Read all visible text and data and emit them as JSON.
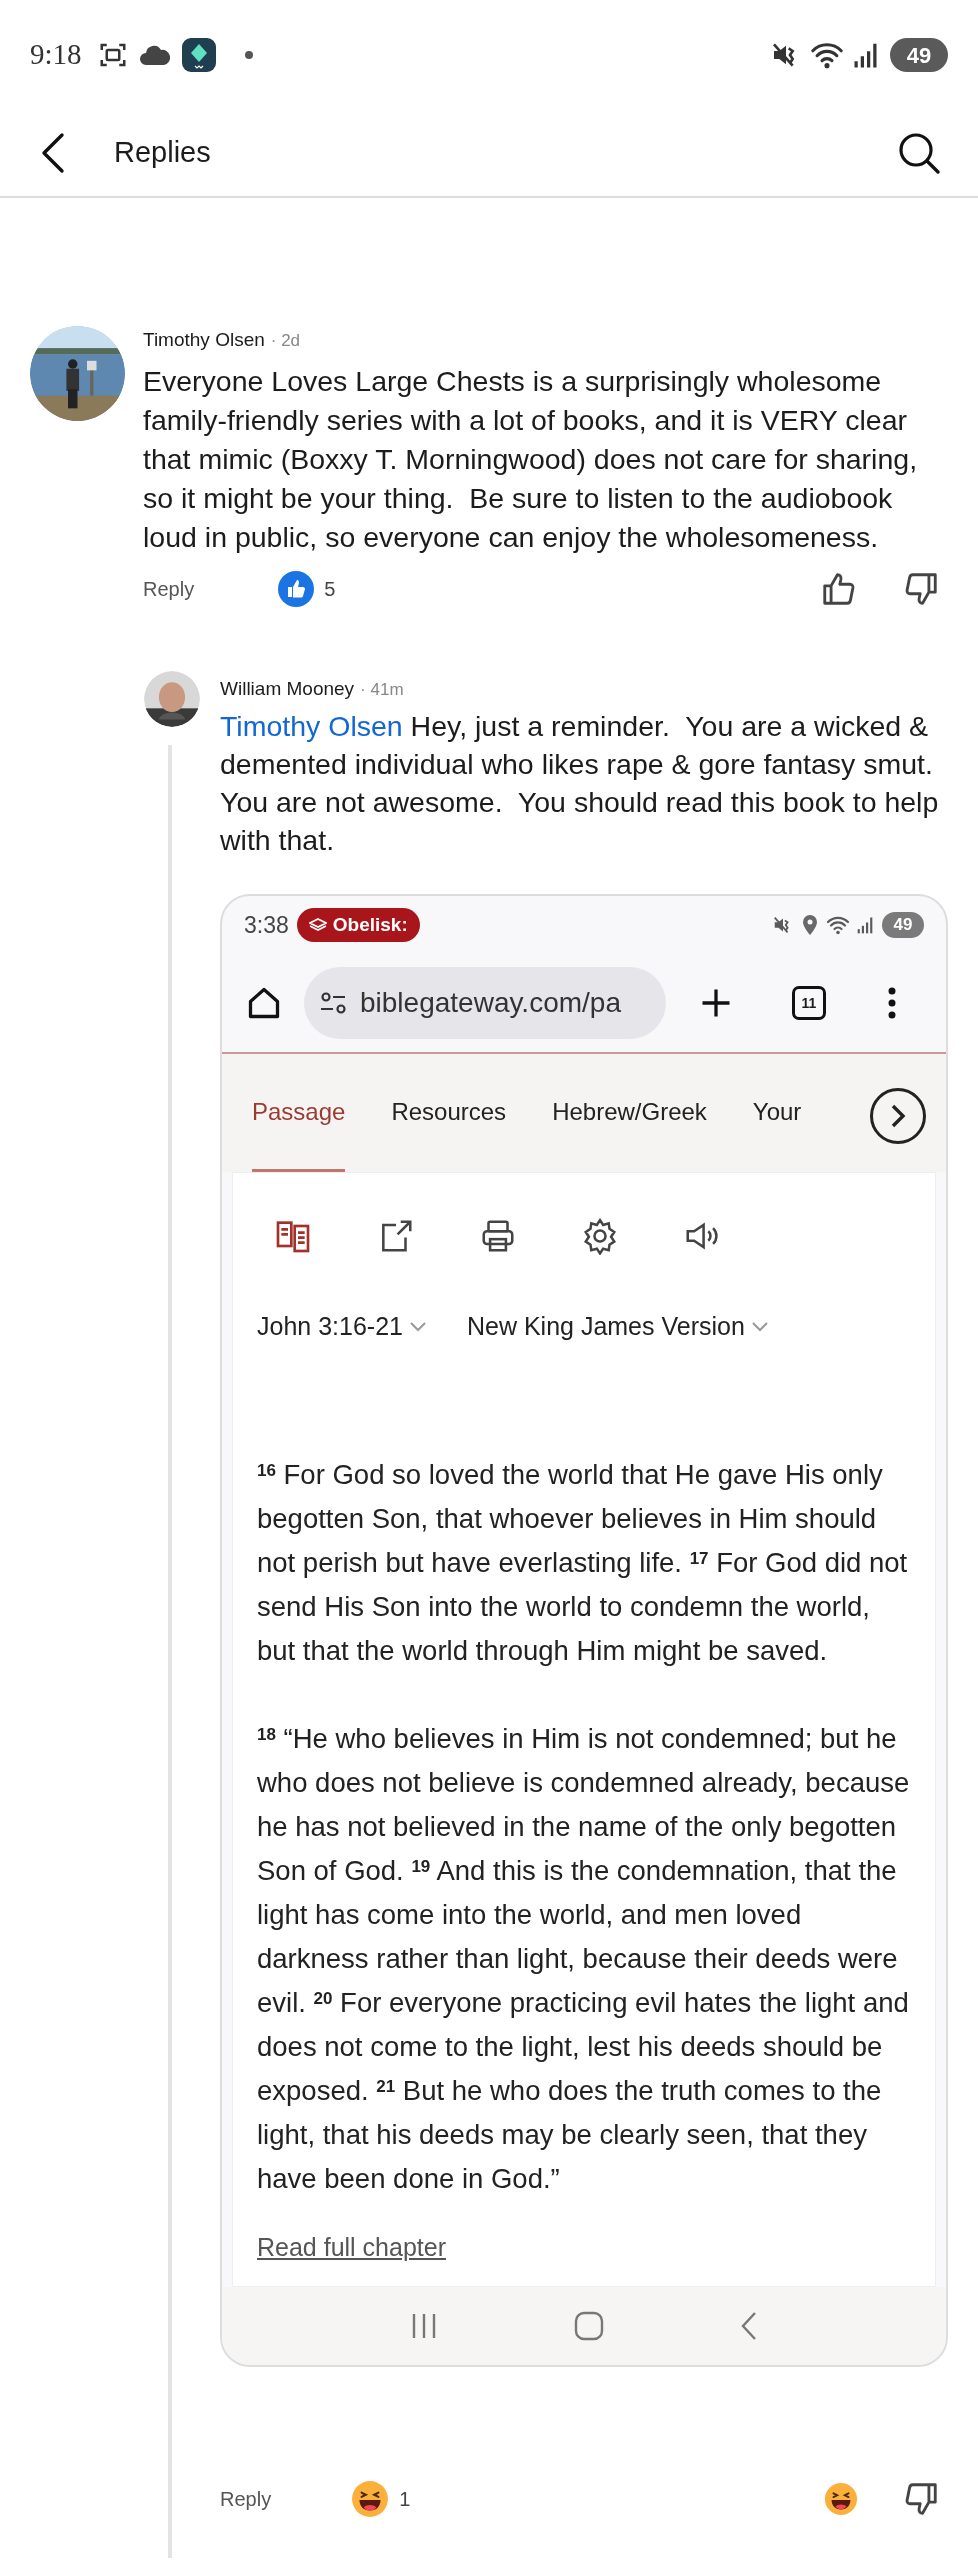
{
  "status_bar": {
    "time": "9:18",
    "battery": "49"
  },
  "header": {
    "title": "Replies"
  },
  "comments": [
    {
      "author": "Timothy Olsen",
      "age": "· 2d",
      "body": "Everyone Loves Large Chests is a surprisingly wholesome family-friendly series with a lot of books, and it is VERY clear that mimic (Boxxy T. Morningwood) does not care for sharing, so it might be your thing.  Be sure to listen to the audiobook loud in public, so everyone can enjoy the wholesomeness.",
      "reply_label": "Reply",
      "reaction": {
        "kind": "like",
        "count": "5"
      },
      "reacted": false
    },
    {
      "author": "William Mooney",
      "age": "· 41m",
      "mention": "Timothy Olsen",
      "body": "Hey, just a reminder.  You are a wicked & demented individual who likes rape & gore fantasy smut.  You are not awesome.  You should read this book to help with that.",
      "reply_label": "Reply",
      "reaction": {
        "kind": "haha",
        "count": "1"
      },
      "reacted": true
    }
  ],
  "attachment": {
    "status_time": "3:38",
    "notification_chip": "Obelisk:",
    "battery": "49",
    "url": "biblegateway.com/pa",
    "tab_count": "11",
    "tabs": [
      {
        "label": "Passage",
        "selected": true
      },
      {
        "label": "Resources",
        "selected": false
      },
      {
        "label": "Hebrew/Greek",
        "selected": false
      },
      {
        "label": "Your",
        "selected": false
      }
    ],
    "reference": "John 3:16-21",
    "version": "New King James Version",
    "paragraphs": [
      "$^{16}$ For God so loved the world that He gave His only begotten Son, that whoever believes in Him should not perish but have everlasting life. $^{17}$ For God did not send His Son into the world to condemn the world, but that the world through Him might be saved.",
      "$^{18}$ “He who believes in Him is not condemned; but he who does not believe is condemned already, because he has not believed in the name of the only begotten Son of God. $^{19}$ And this is the condemnation, that the light has come into the world, and men loved darkness rather than light, because their deeds were evil. $^{20}$ For everyone practicing evil hates the light and does not come to the light, lest his deeds should be exposed. $^{21}$ But he who does the truth comes to the light, that his deeds may be clearly seen, that they have been done in God.”"
    ],
    "link": "Read full chapter"
  }
}
